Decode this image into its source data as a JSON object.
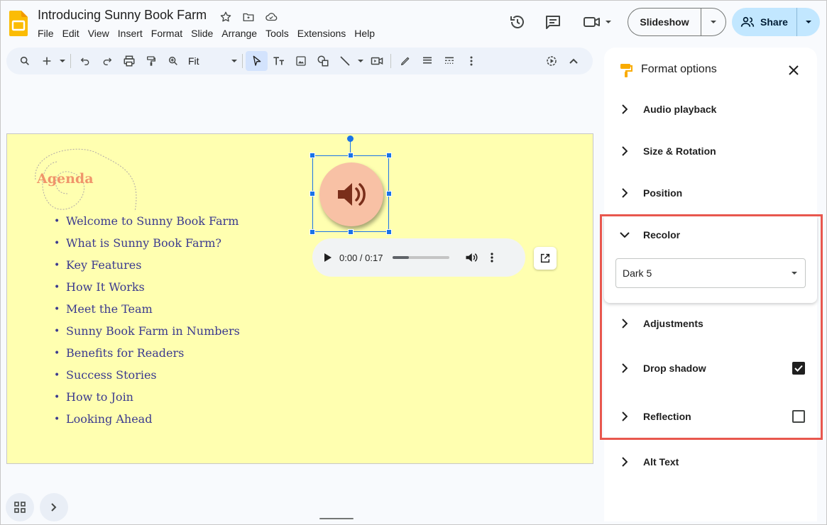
{
  "app": {
    "doc_title": "Introducing Sunny Book Farm",
    "menu": [
      "File",
      "Edit",
      "View",
      "Insert",
      "Format",
      "Slide",
      "Arrange",
      "Tools",
      "Extensions",
      "Help"
    ],
    "slideshow_label": "Slideshow",
    "share_label": "Share"
  },
  "toolbar": {
    "zoom_value": "Fit"
  },
  "slide": {
    "heading": "Agenda",
    "items": [
      "Welcome to Sunny Book Farm",
      "What is Sunny Book Farm?",
      "Key Features",
      "How It Works",
      "Meet the Team",
      "Sunny Book Farm in Numbers",
      "Benefits for Readers",
      "Success Stories",
      "How to Join",
      "Looking Ahead"
    ],
    "player": {
      "time": "0:00 / 0:17",
      "progress": 0.28
    }
  },
  "panel": {
    "title": "Format options",
    "sections": {
      "audio_playback": "Audio playback",
      "size_rotation": "Size & Rotation",
      "position": "Position",
      "recolor": "Recolor",
      "adjustments": "Adjustments",
      "drop_shadow": "Drop shadow",
      "reflection": "Reflection",
      "alt_text": "Alt Text"
    },
    "recolor_value": "Dark 5",
    "drop_shadow_checked": true,
    "reflection_checked": false
  },
  "colors": {
    "accent_blue": "#1a73e8",
    "share_bg": "#c2e7ff",
    "slide_bg": "#ffffb0",
    "agenda_heading": "#f0956b",
    "agenda_text": "#3b3a8f",
    "highlight": "#e8574e"
  }
}
